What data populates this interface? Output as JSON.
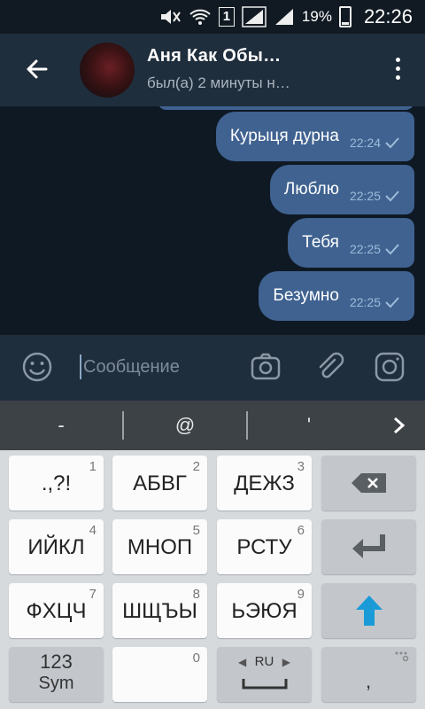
{
  "status_bar": {
    "battery": "19%",
    "time": "22:26",
    "sim": "1"
  },
  "header": {
    "title": "Аня Как Обы…",
    "subtitle": "был(а) 2 минуты н…"
  },
  "messages": [
    {
      "text": "Курыця дурна",
      "time": "22:24"
    },
    {
      "text": "Люблю",
      "time": "22:25"
    },
    {
      "text": "Тебя",
      "time": "22:25"
    },
    {
      "text": "Безумно",
      "time": "22:25"
    }
  ],
  "input": {
    "placeholder": "Сообщение"
  },
  "keyboard": {
    "suggestions": [
      "-",
      "@",
      "'"
    ],
    "keys": [
      {
        "label": ".,?!",
        "num": "1"
      },
      {
        "label": "АБВГ",
        "num": "2"
      },
      {
        "label": "ДЕЖЗ",
        "num": "3"
      },
      {
        "label": "ИЙКЛ",
        "num": "4"
      },
      {
        "label": "МНОП",
        "num": "5"
      },
      {
        "label": "РСТУ",
        "num": "6"
      },
      {
        "label": "ФХЦЧ",
        "num": "7"
      },
      {
        "label": "ШЩЪЫ",
        "num": "8"
      },
      {
        "label": "ЬЭЮЯ",
        "num": "9"
      },
      {
        "label": "",
        "num": "0"
      }
    ],
    "sym_label_1": "123",
    "sym_label_2": "Sym",
    "lang": "RU",
    "comma": ","
  },
  "colors": {
    "accent": "#3f6290",
    "enter_arrow": "#1a9bd7"
  }
}
